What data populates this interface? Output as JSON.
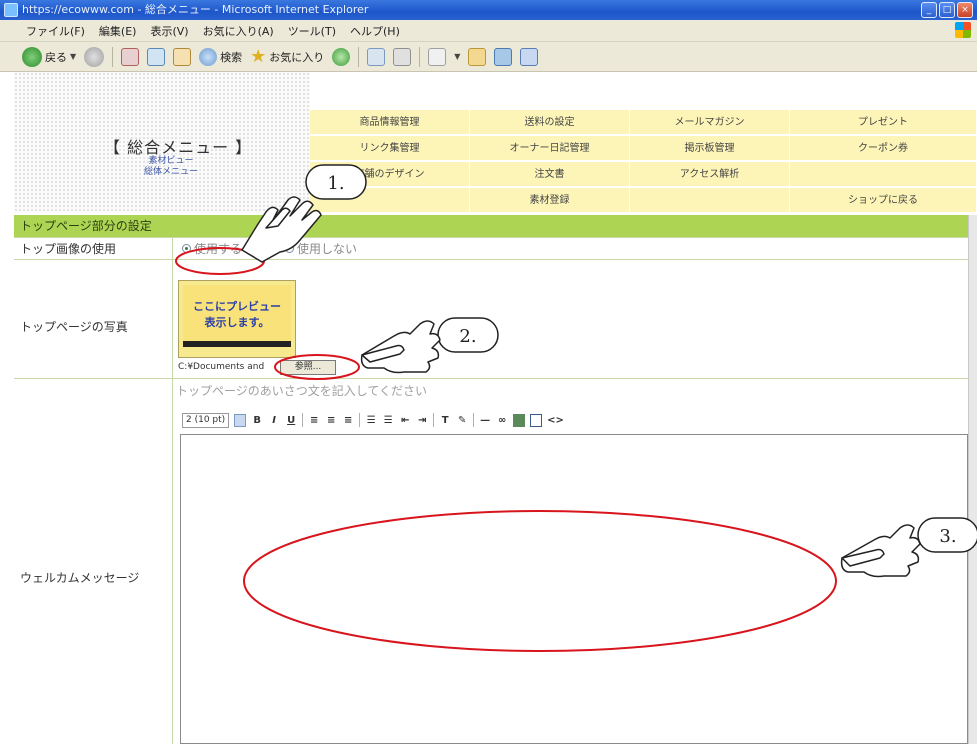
{
  "window": {
    "title": "https://ecowww.com - 総合メニュー - Microsoft Internet Explorer",
    "controls": [
      "_",
      "□",
      "×"
    ]
  },
  "menubar": {
    "items": [
      "ファイル(F)",
      "編集(E)",
      "表示(V)",
      "お気に入り(A)",
      "ツール(T)",
      "ヘルプ(H)"
    ]
  },
  "toolbar": {
    "back_label": "戻る",
    "search_label": "検索",
    "favorites_label": "お気に入り"
  },
  "header": {
    "title": "【 総合メニュー 】",
    "sub_links": [
      "素材ビュー",
      "総体メニュー"
    ]
  },
  "menu": {
    "items": [
      {
        "label": "商品情報管理"
      },
      {
        "label": "送料の設定"
      },
      {
        "label": "メールマガジン"
      },
      {
        "label": "プレゼント"
      },
      {
        "label": "リンク集管理"
      },
      {
        "label": "オーナー日記管理"
      },
      {
        "label": "掲示板管理"
      },
      {
        "label": "クーポン券"
      },
      {
        "label": "店舗のデザイン"
      },
      {
        "label": "注文書"
      },
      {
        "label": "アクセス解析"
      },
      {
        "label": ""
      },
      {
        "label": ""
      },
      {
        "label": "素材登録"
      },
      {
        "label": ""
      },
      {
        "label": "ショップに戻る"
      }
    ]
  },
  "section": {
    "title": "トップページ部分の設定"
  },
  "form": {
    "top_image_label": "トップ画像の使用",
    "radio_use": "使用する",
    "radio_no_use": "使用しない",
    "photo_label": "トップページの写真",
    "preview_text": "ここにプレビュー\n表示します。",
    "file_path": "C:¥Documents and",
    "browse_label": "参照...",
    "welcome_label": "ウェルカムメッセージ",
    "editor_placeholder": "トップページのあいさつ文を記入してください",
    "font_size": "2 (10 pt)"
  },
  "annotations": {
    "steps": [
      "1.",
      "2.",
      "3."
    ]
  }
}
